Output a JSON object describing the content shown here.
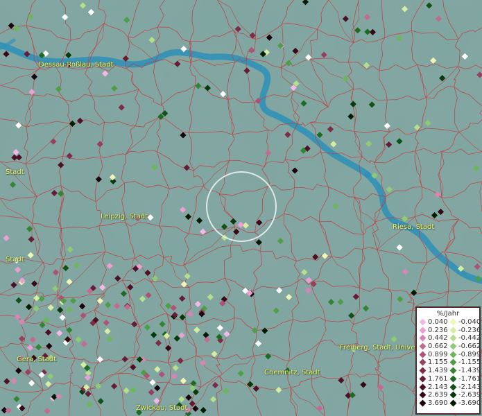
{
  "map": {
    "background_color": "#7fa6a1",
    "border_color": "#c43a3a",
    "river_color": "#2d8fb8",
    "label_color": "#f3f05a",
    "places": [
      {
        "name": "Dessau-Roßlau, Stadt"
      },
      {
        "name": "Stadt"
      },
      {
        "name": "Leipzig, Stadt"
      },
      {
        "name": "Stadt"
      },
      {
        "name": "Riesa, Stadt"
      },
      {
        "name": "Gera, Stadt"
      },
      {
        "name": "Freiberg, Stadt, Univer"
      },
      {
        "name": "Chemnitz, Stadt"
      },
      {
        "name": "Zwickau, Stadt"
      }
    ]
  },
  "legend": {
    "title": "%/Jahr",
    "positive": [
      {
        "label": "0.040",
        "color": "#f4b8e8"
      },
      {
        "label": "0.236",
        "color": "#eba0d4"
      },
      {
        "label": "0.442",
        "color": "#d985b4"
      },
      {
        "label": "0.662",
        "color": "#c46a92"
      },
      {
        "label": "0.899",
        "color": "#ae5377"
      },
      {
        "label": "1.155",
        "color": "#973f5f"
      },
      {
        "label": "1.439",
        "color": "#7e2b48"
      },
      {
        "label": "1.761",
        "color": "#661c36"
      },
      {
        "label": "2.143",
        "color": "#4e1025"
      },
      {
        "label": "2.639",
        "color": "#360716"
      },
      {
        "label": "3.690",
        "color": "#1a020a"
      }
    ],
    "negative": [
      {
        "label": "-0.040",
        "color": "#f2f5b5"
      },
      {
        "label": "-0.236",
        "color": "#d6eea2"
      },
      {
        "label": "-0.442",
        "color": "#b5df8c"
      },
      {
        "label": "-0.662",
        "color": "#8fcb74"
      },
      {
        "label": "-0.899",
        "color": "#6cb65c"
      },
      {
        "label": "-1.155",
        "color": "#4d9e45"
      },
      {
        "label": "-1.439",
        "color": "#338533"
      },
      {
        "label": "-1.761",
        "color": "#1f6b23"
      },
      {
        "label": "-2.143",
        "color": "#115216"
      },
      {
        "label": "-2.639",
        "color": "#06390c"
      },
      {
        "label": "-3.690",
        "color": "#021c04"
      }
    ]
  }
}
